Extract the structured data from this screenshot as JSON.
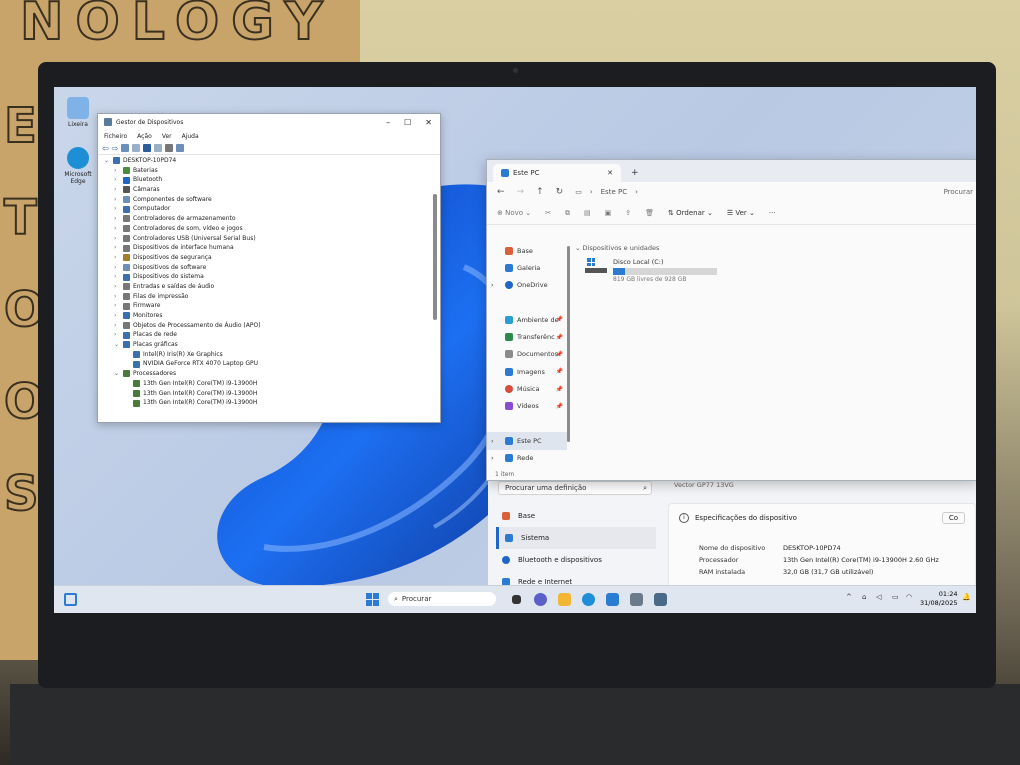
{
  "desktop": {
    "icons": [
      {
        "label": "Lixeira",
        "color": "#7fb2e6"
      },
      {
        "label": "Microsoft Edge",
        "color": "#1e8fd6"
      }
    ]
  },
  "device_manager": {
    "title": "Gestor de Dispositivos",
    "menu": [
      "Ficheiro",
      "Ação",
      "Ver",
      "Ajuda"
    ],
    "tree": [
      {
        "label": "DESKTOP-10PD74",
        "level": 0,
        "color": "#3a6fb0"
      },
      {
        "label": "Baterias",
        "level": 1,
        "color": "#4a8d3a"
      },
      {
        "label": "Bluetooth",
        "level": 1,
        "color": "#1f66c7"
      },
      {
        "label": "Câmaras",
        "level": 1,
        "color": "#555"
      },
      {
        "label": "Componentes de software",
        "level": 1,
        "color": "#6b8fb8"
      },
      {
        "label": "Computador",
        "level": 1,
        "color": "#3a6fb0"
      },
      {
        "label": "Controladores de armazenamento",
        "level": 1,
        "color": "#777"
      },
      {
        "label": "Controladores de som, vídeo e jogos",
        "level": 1,
        "color": "#777"
      },
      {
        "label": "Controladores USB (Universal Serial Bus)",
        "level": 1,
        "color": "#777"
      },
      {
        "label": "Dispositivos de interface humana",
        "level": 1,
        "color": "#777"
      },
      {
        "label": "Dispositivos de segurança",
        "level": 1,
        "color": "#a57c2a"
      },
      {
        "label": "Dispositivos de software",
        "level": 1,
        "color": "#6b8fb8"
      },
      {
        "label": "Dispositivos do sistema",
        "level": 1,
        "color": "#3a6fb0"
      },
      {
        "label": "Entradas e saídas de áudio",
        "level": 1,
        "color": "#777"
      },
      {
        "label": "Filas de impressão",
        "level": 1,
        "color": "#777"
      },
      {
        "label": "Firmware",
        "level": 1,
        "color": "#777"
      },
      {
        "label": "Monitores",
        "level": 1,
        "color": "#3a6fb0"
      },
      {
        "label": "Objetos de Processamento de Áudio (APO)",
        "level": 1,
        "color": "#777"
      },
      {
        "label": "Placas de rede",
        "level": 1,
        "color": "#3a6fb0"
      },
      {
        "label": "Placas gráficas",
        "level": 1,
        "color": "#3a6fb0",
        "expanded": true
      },
      {
        "label": "Intel(R) Iris(R) Xe Graphics",
        "level": 2,
        "color": "#3a6fb0"
      },
      {
        "label": "NVIDIA GeForce RTX 4070 Laptop GPU",
        "level": 2,
        "color": "#3a6fb0"
      },
      {
        "label": "Processadores",
        "level": 1,
        "color": "#4a7a3a",
        "expanded": true
      },
      {
        "label": "13th Gen Intel(R) Core(TM) i9-13900H",
        "level": 2,
        "color": "#4a7a3a"
      },
      {
        "label": "13th Gen Intel(R) Core(TM) i9-13900H",
        "level": 2,
        "color": "#4a7a3a"
      },
      {
        "label": "13th Gen Intel(R) Core(TM) i9-13900H",
        "level": 2,
        "color": "#4a7a3a"
      }
    ]
  },
  "explorer": {
    "tab_title": "Este PC",
    "breadcrumb": "Este PC",
    "search_placeholder": "Procurar",
    "toolbar": {
      "new": "Novo",
      "sort": "Ordenar",
      "view": "Ver",
      "more": "···"
    },
    "sidebar": [
      {
        "label": "Base",
        "color": "#d9603b",
        "pinned": false
      },
      {
        "label": "Galeria",
        "color": "#2b7bd3",
        "pinned": false
      },
      {
        "label": "OneDrive",
        "color": "#1f66c7",
        "pinned": false,
        "chevron": true
      },
      {
        "label": "",
        "color": "",
        "pinned": false,
        "spacer": true
      },
      {
        "label": "Ambiente de",
        "color": "#2b9bd3",
        "pinned": true
      },
      {
        "label": "Transferênc",
        "color": "#2b8a4a",
        "pinned": true
      },
      {
        "label": "Documentos",
        "color": "#8a8a8a",
        "pinned": true
      },
      {
        "label": "Imagens",
        "color": "#2b7bd3",
        "pinned": true
      },
      {
        "label": "Música",
        "color": "#d94b3b",
        "pinned": true
      },
      {
        "label": "Vídeos",
        "color": "#8a4bd3",
        "pinned": true
      },
      {
        "label": "",
        "color": "",
        "pinned": false,
        "spacer": true
      },
      {
        "label": "Este PC",
        "color": "#2b7bd3",
        "pinned": false,
        "chevron": true,
        "active": true
      },
      {
        "label": "Rede",
        "color": "#2b7bd3",
        "pinned": false,
        "chevron": true
      }
    ],
    "section_header": "Dispositivos e unidades",
    "drive": {
      "name": "Disco Local (C:)",
      "free_text": "819 GB livres de 928 GB",
      "used_fraction": 0.12
    },
    "status": "1 item"
  },
  "settings": {
    "search_placeholder": "Procurar uma definição",
    "behind_text": "Vector GP77 13VG",
    "nav": [
      {
        "label": "Base",
        "active": false,
        "color": "#d9603b"
      },
      {
        "label": "Sistema",
        "active": true,
        "color": "#2b7bd3"
      },
      {
        "label": "Bluetooth e dispositivos",
        "active": false,
        "color": "#1f66c7"
      },
      {
        "label": "Rede e Internet",
        "active": false,
        "color": "#2b7bd3"
      }
    ],
    "specs_header": "Especificações do dispositivo",
    "copy_button": "Co",
    "specs": [
      {
        "k": "Nome do dispositivo",
        "v": "DESKTOP-10PD74"
      },
      {
        "k": "Processador",
        "v": "13th Gen Intel(R) Core(TM) i9-13900H   2.60 GHz"
      },
      {
        "k": "RAM instalada",
        "v": "32,0 GB (31,7 GB utilizável)"
      }
    ]
  },
  "taskbar": {
    "search_placeholder": "Procurar",
    "time": "01:24",
    "date": "31/08/2025"
  }
}
